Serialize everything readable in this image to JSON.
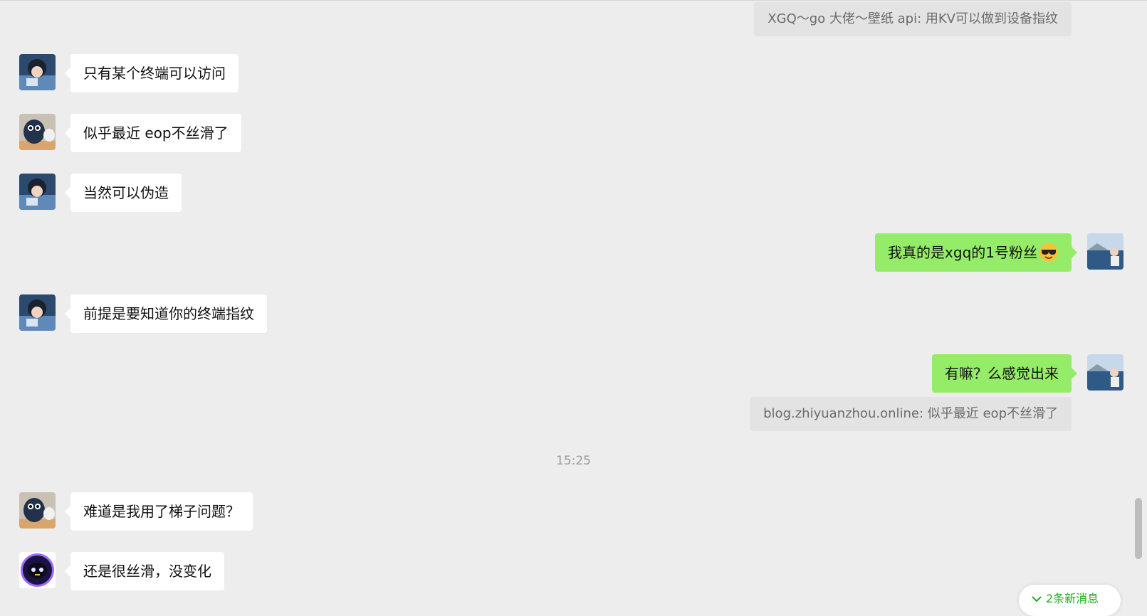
{
  "quotes": {
    "top": "XGQ～go 大佬～壁纸 api: 用KV可以做到设备指纹",
    "blog": "blog.zhiyuanzhou.online: 似乎最近 eop不丝滑了"
  },
  "messages": {
    "m1": {
      "text": "只有某个终端可以访问",
      "avatar": "anime-boy-avatar"
    },
    "m2": {
      "text": "似乎最近 eop不丝滑了",
      "avatar": "penguin-avatar"
    },
    "m3": {
      "text": "当然可以伪造",
      "avatar": "anime-boy-avatar"
    },
    "m4": {
      "text": "我真的是xgq的1号粉丝",
      "emoji": "sunglasses-emoji",
      "avatar": "seaside-avatar"
    },
    "m5": {
      "text": "前提是要知道你的终端指纹",
      "avatar": "anime-boy-avatar"
    },
    "m6": {
      "text": "有嘛？么感觉出来",
      "avatar": "seaside-avatar"
    },
    "m7": {
      "text": "难道是我用了梯子问题？",
      "avatar": "penguin-avatar"
    },
    "m8": {
      "text": "还是很丝滑，没变化",
      "avatar": "robot-avatar"
    }
  },
  "timestamp": "15:25",
  "new_messages": "2条新消息",
  "colors": {
    "background": "#ededed",
    "self_bubble": "#95ec69",
    "other_bubble": "#ffffff",
    "quote_bubble": "#e3e3e3",
    "accent": "#1aad19"
  }
}
